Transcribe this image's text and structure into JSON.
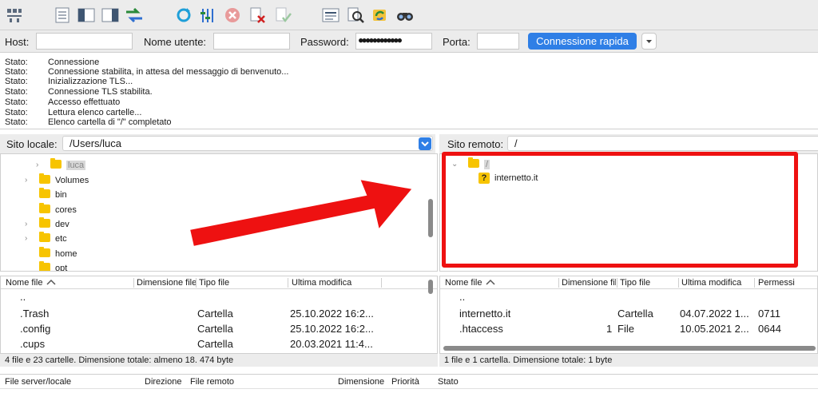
{
  "quickconnect": {
    "host_label": "Host:",
    "host_value": "",
    "user_label": "Nome utente:",
    "user_value": "",
    "password_label": "Password:",
    "password_value": "●●●●●●●●●●●●",
    "port_label": "Porta:",
    "port_value": "",
    "connect_label": "Connessione rapida"
  },
  "log": [
    {
      "label": "Stato:",
      "text": "Connessione"
    },
    {
      "label": "Stato:",
      "text": "Connessione stabilita, in attesa del messaggio di benvenuto..."
    },
    {
      "label": "Stato:",
      "text": "Inizializzazione TLS..."
    },
    {
      "label": "Stato:",
      "text": "Connessione TLS stabilita."
    },
    {
      "label": "Stato:",
      "text": "Accesso effettuato"
    },
    {
      "label": "Stato:",
      "text": "Lettura elenco cartelle..."
    },
    {
      "label": "Stato:",
      "text": "Elenco cartella di \"/\" completato"
    }
  ],
  "local": {
    "site_label": "Sito locale:",
    "site_path": "/Users/luca",
    "tree": [
      {
        "name": "luca",
        "expandable": true,
        "selected": true
      },
      {
        "name": "Volumes",
        "expandable": true
      },
      {
        "name": "bin",
        "expandable": false
      },
      {
        "name": "cores",
        "expandable": false
      },
      {
        "name": "dev",
        "expandable": true
      },
      {
        "name": "etc",
        "expandable": true
      },
      {
        "name": "home",
        "expandable": false
      },
      {
        "name": "opt",
        "expandable": false
      }
    ],
    "columns": [
      "Nome file",
      "Dimensione file",
      "Tipo file",
      "Ultima modifica"
    ],
    "files": [
      {
        "name": "..",
        "size": "",
        "type": "",
        "modified": ""
      },
      {
        "name": ".Trash",
        "size": "",
        "type": "Cartella",
        "modified": "25.10.2022 16:2..."
      },
      {
        "name": ".config",
        "size": "",
        "type": "Cartella",
        "modified": "25.10.2022 16:2..."
      },
      {
        "name": ".cups",
        "size": "",
        "type": "Cartella",
        "modified": "20.03.2021 11:4..."
      }
    ],
    "status": "4 file e 23 cartelle. Dimensione totale: almeno 18. 474 byte"
  },
  "remote": {
    "site_label": "Sito remoto:",
    "site_path": "/",
    "tree_root": "/",
    "tree_child": "internetto.it",
    "columns": [
      "Nome file",
      "Dimensione file",
      "Tipo file",
      "Ultima modifica",
      "Permessi"
    ],
    "files": [
      {
        "name": "..",
        "size": "",
        "type": "",
        "modified": "",
        "perms": ""
      },
      {
        "name": "internetto.it",
        "size": "",
        "type": "Cartella",
        "modified": "04.07.2022 1...",
        "perms": "0711"
      },
      {
        "name": ".htaccess",
        "size": "1",
        "type": "File",
        "modified": "10.05.2021 2...",
        "perms": "0644"
      }
    ],
    "status": "1 file e 1 cartella. Dimensione totale: 1 byte"
  },
  "queue": {
    "columns": [
      "File server/locale",
      "Direzione",
      "File remoto",
      "Dimensione",
      "Priorità",
      "Stato"
    ]
  },
  "colors": {
    "accent": "#2f7fe6",
    "folder": "#f7c400",
    "annotation": "#ee1111"
  }
}
